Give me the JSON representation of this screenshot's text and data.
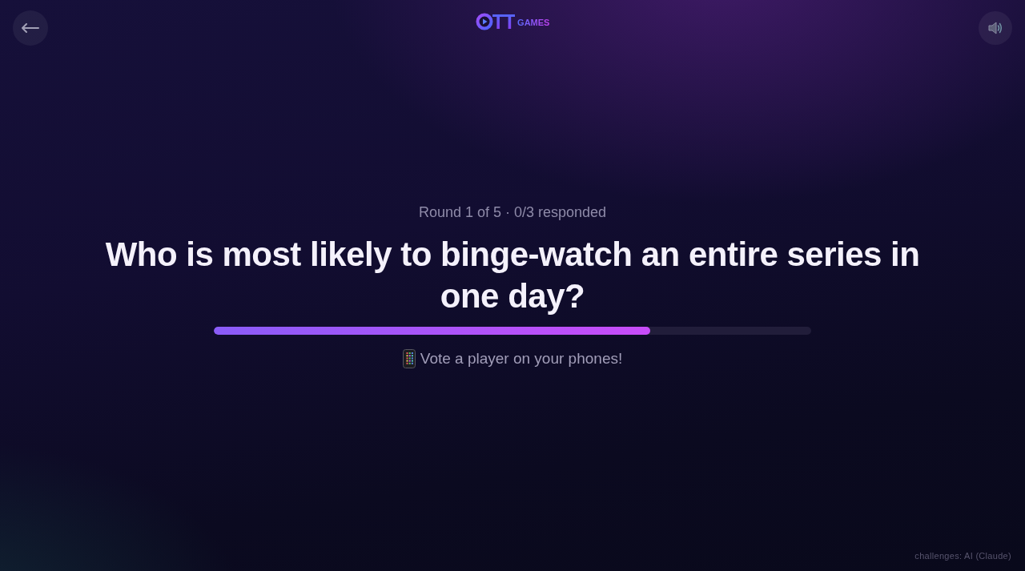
{
  "header": {
    "logo": {
      "letters": "TT",
      "suffix": "GAMES"
    }
  },
  "round_status": "Round 1 of 5 · 0/3 responded",
  "question": "Who is most likely to binge-watch an entire series in one day?",
  "progress": {
    "level": 0.73
  },
  "instruction": "Vote a player on your phones!",
  "footer": "challenges: AI (Claude)"
}
